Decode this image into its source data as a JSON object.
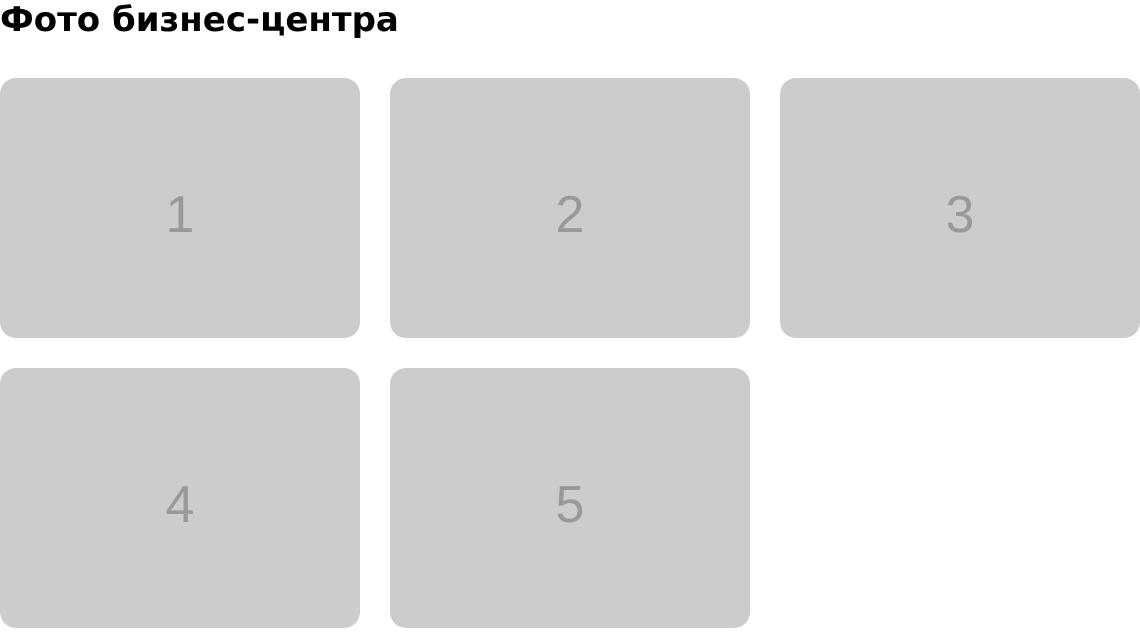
{
  "header": {
    "title": "Фото бизнес-центра"
  },
  "gallery": {
    "tile_color": "#cccccc",
    "label_color": "#999999",
    "photos": [
      {
        "label": "1"
      },
      {
        "label": "2"
      },
      {
        "label": "3"
      },
      {
        "label": "4"
      },
      {
        "label": "5"
      }
    ]
  }
}
